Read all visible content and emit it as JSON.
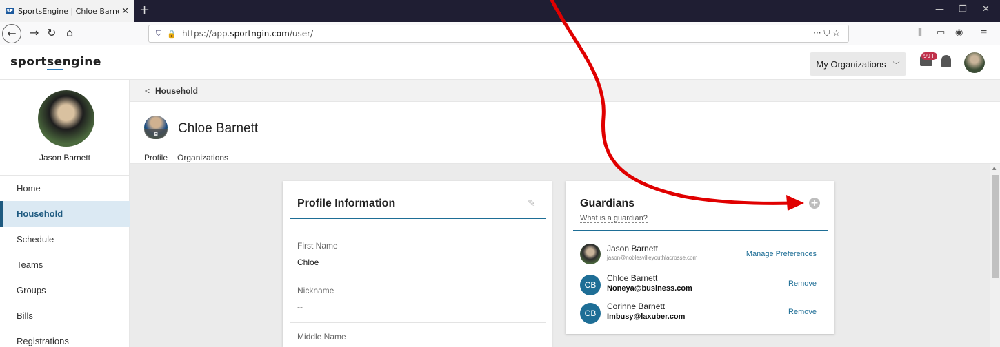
{
  "browser": {
    "tab_title": "SportsEngine | Chloe Barnett -",
    "tab_favicon": "SE",
    "url_prefix": "https://app.",
    "url_domain": "sportngin.com",
    "url_path": "/user/",
    "url_tools": "··· ⛉ ☆"
  },
  "header": {
    "logo_pre": "sport",
    "logo_mid": "se",
    "logo_post": "ngine",
    "org_dropdown": "My Organizations",
    "mail_badge": "99+"
  },
  "sidebar": {
    "user_name": "Jason Barnett",
    "items": [
      {
        "label": "Home"
      },
      {
        "label": "Household"
      },
      {
        "label": "Schedule"
      },
      {
        "label": "Teams"
      },
      {
        "label": "Groups"
      },
      {
        "label": "Bills"
      },
      {
        "label": "Registrations"
      }
    ]
  },
  "breadcrumb": {
    "label": "Household"
  },
  "profile": {
    "name": "Chloe Barnett",
    "tabs": [
      {
        "label": "Profile"
      },
      {
        "label": "Organizations"
      }
    ]
  },
  "profile_card": {
    "title": "Profile Information",
    "fields": [
      {
        "label": "First Name",
        "value": "Chloe"
      },
      {
        "label": "Nickname",
        "value": "--"
      },
      {
        "label": "Middle Name",
        "value": ""
      }
    ]
  },
  "guardians_card": {
    "title": "Guardians",
    "help_link": "What is a guardian?",
    "guardians": [
      {
        "name": "Jason Barnett",
        "email": "jason@noblesvilleyouthlacrosse.com",
        "action": "Manage Preferences",
        "initials": ""
      },
      {
        "name": "Chloe Barnett",
        "email": "Noneya@business.com",
        "action": "Remove",
        "initials": "CB"
      },
      {
        "name": "Corinne Barnett",
        "email": "Imbusy@laxuber.com",
        "action": "Remove",
        "initials": "CB"
      }
    ]
  },
  "colors": {
    "accent": "#1e6e96",
    "annotation": "#e00000"
  }
}
